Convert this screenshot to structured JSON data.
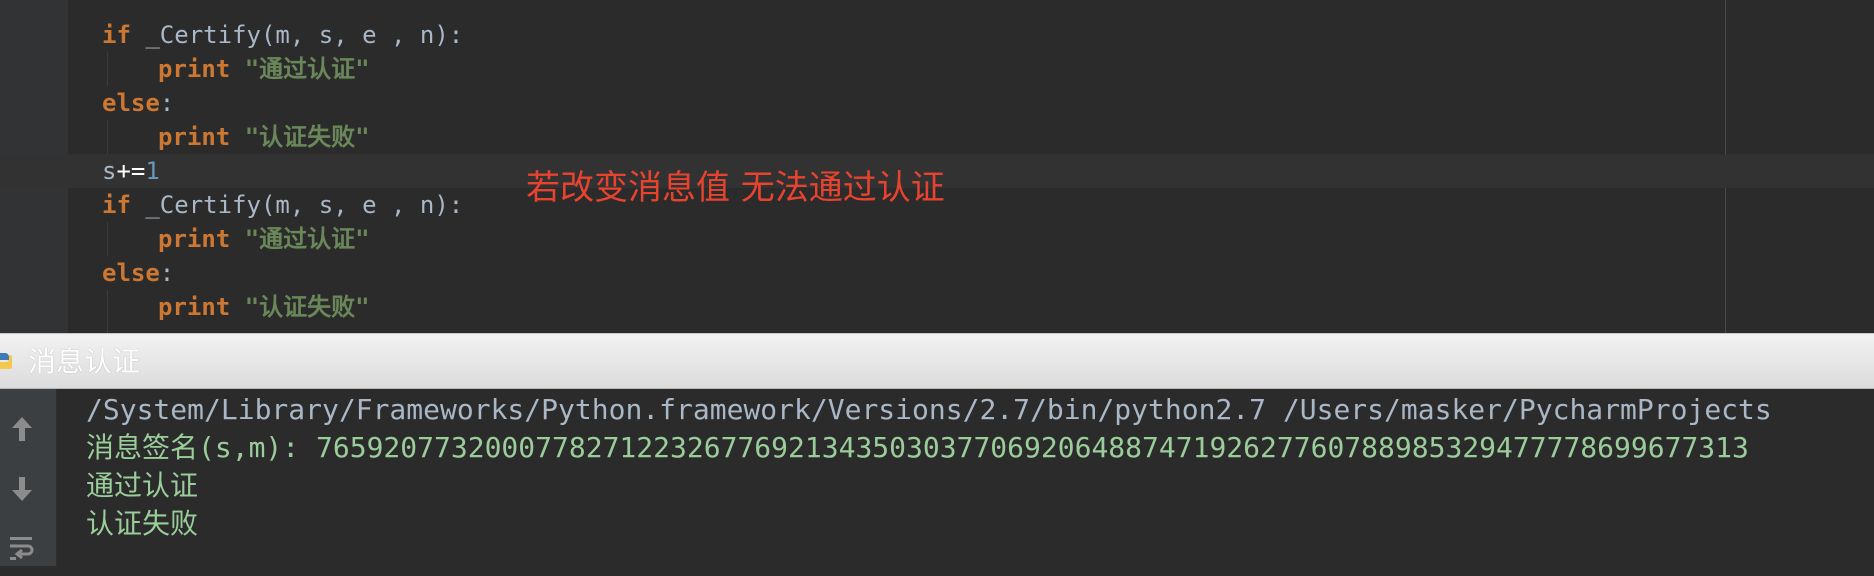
{
  "editor": {
    "lines": [
      {
        "indent": 1,
        "kw": "if",
        "rest": " _Certify(m, s, e , n):"
      },
      {
        "indent": 2,
        "kw": "print",
        "str": "\"通过认证\""
      },
      {
        "indent": 1,
        "kw": "else",
        "rest": ":"
      },
      {
        "indent": 2,
        "kw": "print",
        "str": "\"认证失败\""
      },
      {
        "indent": 1,
        "var": "s",
        "op": "+=",
        "num": "1",
        "current": true
      },
      {
        "indent": 1,
        "kw": "if",
        "rest": " _Certify(m, s, e , n):"
      },
      {
        "indent": 2,
        "kw": "print",
        "str": "\"通过认证\""
      },
      {
        "indent": 1,
        "kw": "else",
        "rest": ":"
      },
      {
        "indent": 2,
        "kw": "print",
        "str": "\"认证失败\""
      }
    ],
    "annotation": "若改变消息值 无法通过认证"
  },
  "run_panel": {
    "title": "消息认证",
    "icon": "python-icon"
  },
  "console": {
    "tools": [
      "up-arrow-icon",
      "down-arrow-icon",
      "soft-wrap-icon"
    ],
    "lines": [
      "/System/Library/Frameworks/Python.framework/Versions/2.7/bin/python2.7 /Users/masker/PycharmProjects",
      "消息签名(s,m): 7659207732000778271223267769213435030377069206488747192627760788985329477778699677313",
      "通过认证",
      "认证失败"
    ]
  },
  "colors": {
    "keyword": "#cc7832",
    "string": "#6a8759",
    "annotation": "#e8432f",
    "console_text": "#9acd9a"
  }
}
